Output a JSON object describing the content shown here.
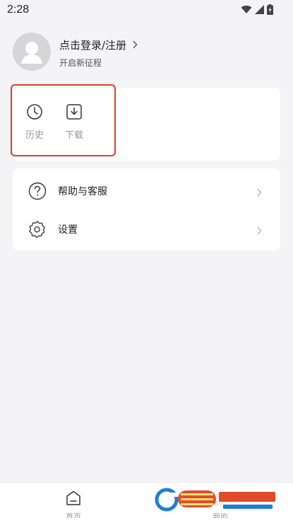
{
  "status_bar": {
    "time": "2:28",
    "icons": [
      "wifi-icon",
      "signal-icon",
      "battery-icon"
    ]
  },
  "profile": {
    "login_label": "点击登录/注册",
    "subtitle": "开启新征程"
  },
  "quick_actions": [
    {
      "label": "历史",
      "icon": "clock-icon"
    },
    {
      "label": "下载",
      "icon": "download-icon"
    }
  ],
  "menu": [
    {
      "label": "帮助与客服",
      "icon": "question-icon"
    },
    {
      "label": "设置",
      "icon": "gear-icon"
    }
  ],
  "bottom_nav": {
    "home_label": "首页",
    "mine_label": "我的"
  },
  "colors": {
    "background": "#f4f4f6",
    "card": "#ffffff",
    "highlight": "#d9412e",
    "muted_text": "#999999"
  }
}
